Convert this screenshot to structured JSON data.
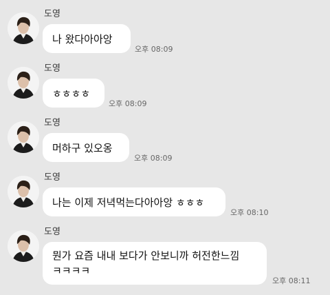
{
  "messages": [
    {
      "sender": "도영",
      "lines": [
        "나 왔다아아앙"
      ],
      "time": "오후 08:09"
    },
    {
      "sender": "도영",
      "lines": [
        "ㅎㅎㅎㅎ"
      ],
      "time": "오후 08:09"
    },
    {
      "sender": "도영",
      "lines": [
        "머하구 있오옹"
      ],
      "time": "오후 08:09"
    },
    {
      "sender": "도영",
      "lines": [
        "나는 이제 저녁먹는다아아앙 ㅎㅎㅎ"
      ],
      "time": "오후 08:10"
    },
    {
      "sender": "도영",
      "lines": [
        "뭔가 요즘 내내 보다가 안보니까 허전한느낌",
        "ㅋㅋㅋㅋ"
      ],
      "time": "오후 08:11"
    }
  ]
}
